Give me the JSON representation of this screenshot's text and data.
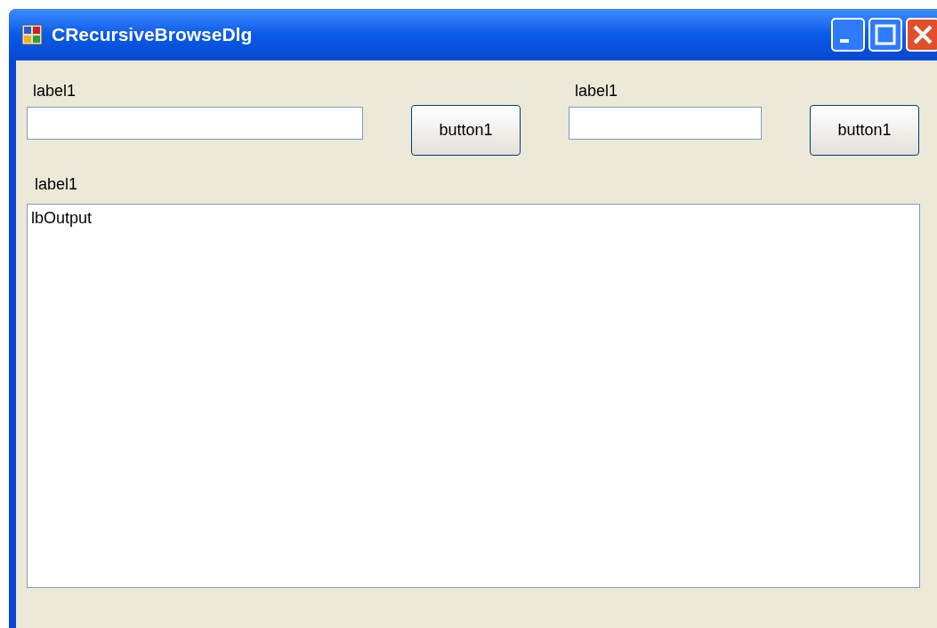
{
  "window": {
    "title": "CRecursiveBrowseDlg"
  },
  "top_row": [
    {
      "kind": "field",
      "label": "label1"
    },
    {
      "kind": "button",
      "label": "button1"
    },
    {
      "kind": "field",
      "label": "label1"
    },
    {
      "kind": "button",
      "label": "button1"
    }
  ],
  "output": {
    "label": "label1",
    "items": [
      "lbOutput"
    ]
  }
}
